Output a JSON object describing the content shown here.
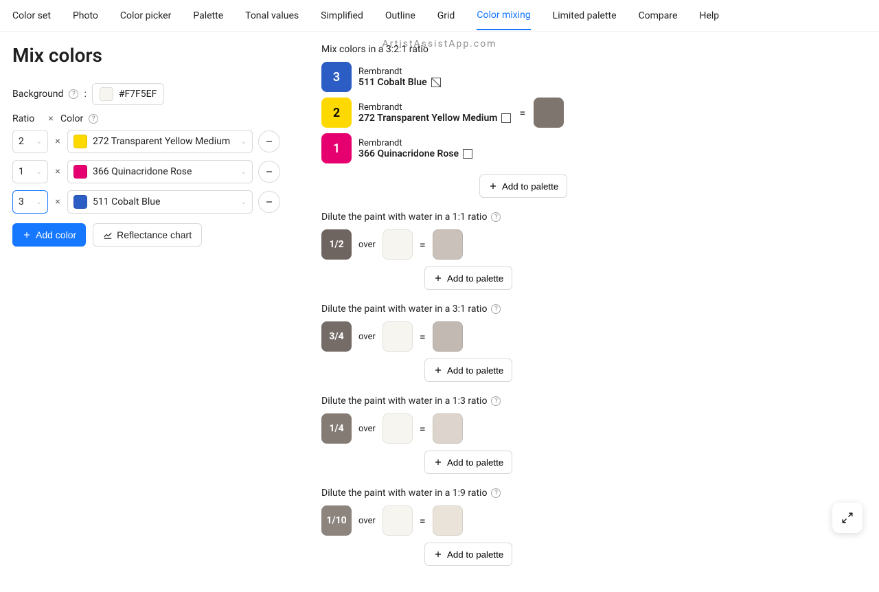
{
  "watermark": "ArtistAssistApp.com",
  "tabs": [
    "Color set",
    "Photo",
    "Color picker",
    "Palette",
    "Tonal values",
    "Simplified",
    "Outline",
    "Grid",
    "Color mixing",
    "Limited palette",
    "Compare",
    "Help"
  ],
  "active_tab": "Color mixing",
  "page_title": "Mix colors",
  "background": {
    "label": "Background",
    "hex": "#F7F5EF"
  },
  "ratio_header": "Ratio",
  "x_char": "×",
  "color_header": "Color",
  "colors": [
    {
      "ratio": "2",
      "name": "272 Transparent Yellow Medium",
      "swatch": "#fdd900",
      "active": false
    },
    {
      "ratio": "1",
      "name": "366 Quinacridone Rose",
      "swatch": "#e6006f",
      "active": false
    },
    {
      "ratio": "3",
      "name": "511 Cobalt Blue",
      "swatch": "#2b5dc4",
      "active": true
    }
  ],
  "add_color_label": "Add color",
  "reflectance_label": "Reflectance chart",
  "mix_title": "Mix colors in a 3:2:1 ratio",
  "brand": "Rembrandt",
  "mix_items": [
    {
      "ratio": "3",
      "cls": "b3",
      "name": "511 Cobalt Blue",
      "diag": true
    },
    {
      "ratio": "2",
      "cls": "b2",
      "name": "272 Transparent Yellow Medium",
      "diag": false
    },
    {
      "ratio": "1",
      "cls": "b1",
      "name": "366 Quinacridone Rose",
      "diag": false
    }
  ],
  "eq": "=",
  "result_color": "#7e756f",
  "add_palette_label": "Add to palette",
  "over_label": "over",
  "dilutions": [
    {
      "title": "Dilute the paint with water in a 1:1 ratio",
      "frac": "1/2",
      "frac_bg": "#6f6560",
      "over_bg": "#F7F5EF",
      "result_bg": "#cac1ba"
    },
    {
      "title": "Dilute the paint with water in a 3:1 ratio",
      "frac": "3/4",
      "frac_bg": "#766c67",
      "over_bg": "#F7F5EF",
      "result_bg": "#c2b9b2"
    },
    {
      "title": "Dilute the paint with water in a 1:3 ratio",
      "frac": "1/4",
      "frac_bg": "#847b75",
      "over_bg": "#F7F5EF",
      "result_bg": "#ddd5cd"
    },
    {
      "title": "Dilute the paint with water in a 1:9 ratio",
      "frac": "1/10",
      "frac_bg": "#8d847e",
      "over_bg": "#F7F5EF",
      "result_bg": "#eae3da"
    }
  ]
}
